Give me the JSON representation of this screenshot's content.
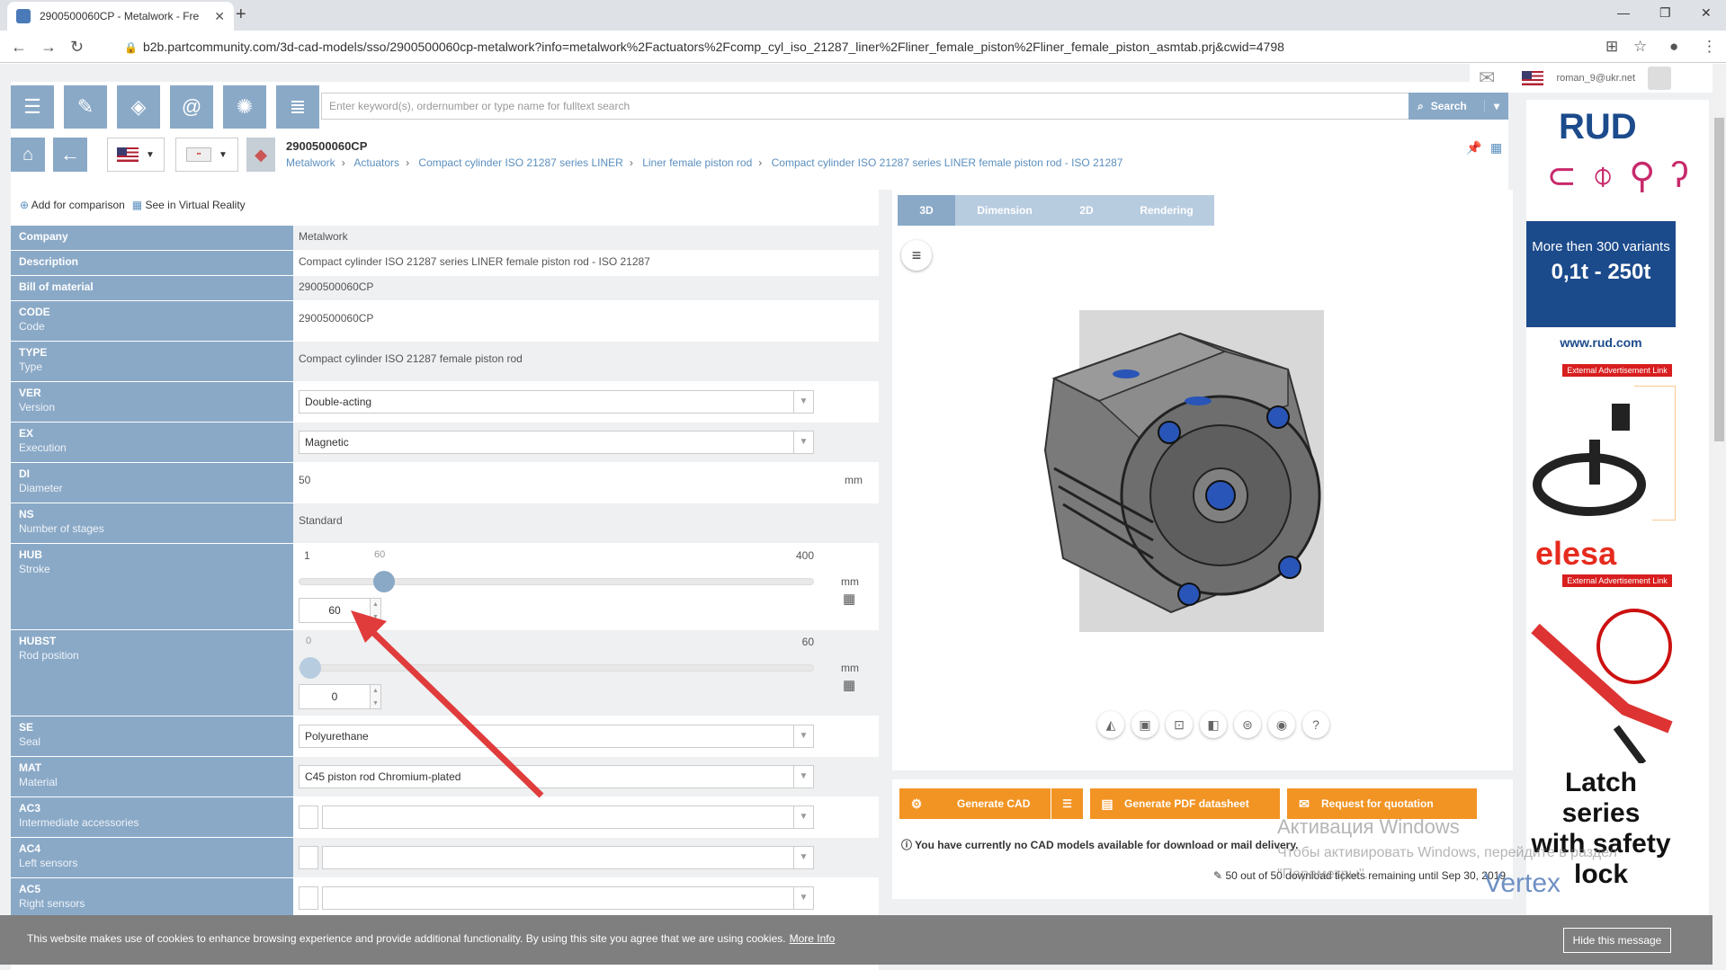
{
  "browser": {
    "tab_title": "2900500060CP - Metalwork - Fre",
    "url": "b2b.partcommunity.com/3d-cad-models/sso/2900500060cp-metalwork?info=metalwork%2Factuators%2Fcomp_cyl_iso_21287_liner%2Fliner_female_piston%2Fliner_female_piston_asmtab.prj&cwid=4798"
  },
  "user": {
    "email": "roman_9@ukr.net"
  },
  "search": {
    "placeholder": "Enter keyword(s), ordernumber or type name for fulltext search",
    "button": "Search"
  },
  "product": {
    "title": "2900500060CP",
    "breadcrumb": [
      "Metalwork",
      "Actuators",
      "Compact cylinder ISO 21287 series LINER",
      "Liner female piston rod",
      "Compact cylinder ISO 21287 series LINER female piston rod - ISO 21287"
    ]
  },
  "actions": {
    "compare": "Add for comparison",
    "vr": "See in Virtual Reality"
  },
  "attributes": {
    "company": {
      "label": "Company",
      "value": "Metalwork"
    },
    "description": {
      "label": "Description",
      "value": "Compact cylinder ISO 21287 series LINER female piston rod - ISO 21287"
    },
    "bom": {
      "label": "Bill of material",
      "value": "2900500060CP"
    },
    "code": {
      "label": "CODE",
      "sub": "Code",
      "value": "2900500060CP"
    },
    "type": {
      "label": "TYPE",
      "sub": "Type",
      "value": "Compact cylinder ISO 21287 female piston rod"
    },
    "ver": {
      "label": "VER",
      "sub": "Version",
      "value": "Double-acting"
    },
    "ex": {
      "label": "EX",
      "sub": "Execution",
      "value": "Magnetic"
    },
    "di": {
      "label": "DI",
      "sub": "Diameter",
      "value": "50",
      "unit": "mm"
    },
    "ns": {
      "label": "NS",
      "sub": "Number of stages",
      "value": "Standard"
    },
    "hub": {
      "label": "HUB",
      "sub": "Stroke",
      "min": "1",
      "current": "60",
      "max": "400",
      "value": "60",
      "unit": "mm",
      "level": 0.15
    },
    "hubst": {
      "label": "HUBST",
      "sub": "Rod position",
      "min": "0",
      "max": "60",
      "value": "0",
      "unit": "mm",
      "level": 0
    },
    "se": {
      "label": "SE",
      "sub": "Seal",
      "value": "Polyurethane"
    },
    "mat": {
      "label": "MAT",
      "sub": "Material",
      "value": "C45 piston rod Chromium-plated"
    },
    "ac3": {
      "label": "AC3",
      "sub": "Intermediate accessories",
      "value": ""
    },
    "ac4": {
      "label": "AC4",
      "sub": "Left sensors",
      "value": ""
    },
    "ac5": {
      "label": "AC5",
      "sub": "Right sensors",
      "value": ""
    }
  },
  "viewer": {
    "tabs": [
      "3D",
      "Dimension",
      "2D",
      "Rendering"
    ]
  },
  "cad": {
    "generate": "Generate CAD",
    "pdf": "Generate PDF datasheet",
    "quote": "Request for quotation",
    "notice": "You have currently no CAD models available for download or mail delivery.",
    "tickets": "50 out of 50 download tickets remaining until Sep 30, 2019"
  },
  "ads": {
    "rud_logo": "RUD",
    "rud_line1": "More then 300 variants",
    "rud_line2": "0,1t - 250t",
    "rud_url": "www.rud.com",
    "ext_label": "External Advertisement Link",
    "elesa": "elesa",
    "latch_line1": "Latch series",
    "latch_line2": "with safety lock"
  },
  "watermark": {
    "line1": "Активация Windows",
    "line2": "Чтобы активировать Windows, перейдите в раздел",
    "line3": "\"Параметры\".",
    "vertex": "Vertex"
  },
  "cookie": {
    "text": "This website makes use of cookies to enhance browsing experience and provide additional functionality. By using this site you agree that we are using cookies.",
    "more": "More Info",
    "hide": "Hide this message"
  },
  "colors": {
    "accent": "#8aa9c7",
    "orange": "#f29423",
    "arrow": "#e03c3c",
    "rud_blue": "#1c4b8c"
  }
}
